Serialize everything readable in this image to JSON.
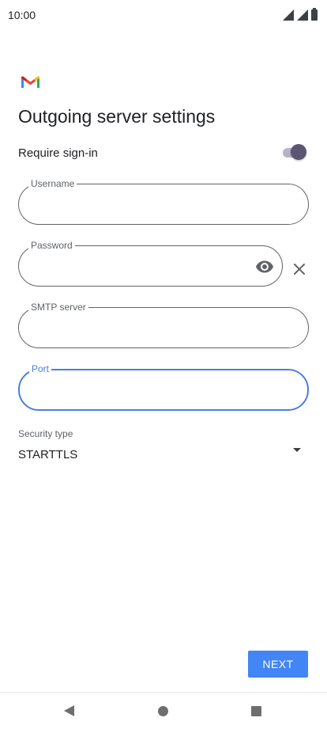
{
  "status_bar": {
    "time": "10:00",
    "icons": [
      "signal-icon",
      "signal-icon",
      "battery-icon"
    ]
  },
  "header": {
    "logo": "gmail-logo",
    "title": "Outgoing server settings"
  },
  "require_signin": {
    "label": "Require sign-in",
    "enabled": true
  },
  "fields": {
    "username": {
      "label": "Username",
      "value": ""
    },
    "password": {
      "label": "Password",
      "value": ""
    },
    "smtp_server": {
      "label": "SMTP server",
      "value": ""
    },
    "port": {
      "label": "Port",
      "value": "",
      "focused": true
    }
  },
  "security": {
    "label": "Security type",
    "value": "STARTTLS"
  },
  "next_button": {
    "label": "NEXT"
  },
  "colors": {
    "accent": "#4285f4",
    "focus": "#4a7ee0",
    "toggle_thumb": "#5d5672",
    "toggle_track": "#b9b3c6"
  },
  "nav_bar": {
    "icons": [
      "back-icon",
      "home-icon",
      "recents-icon"
    ]
  }
}
